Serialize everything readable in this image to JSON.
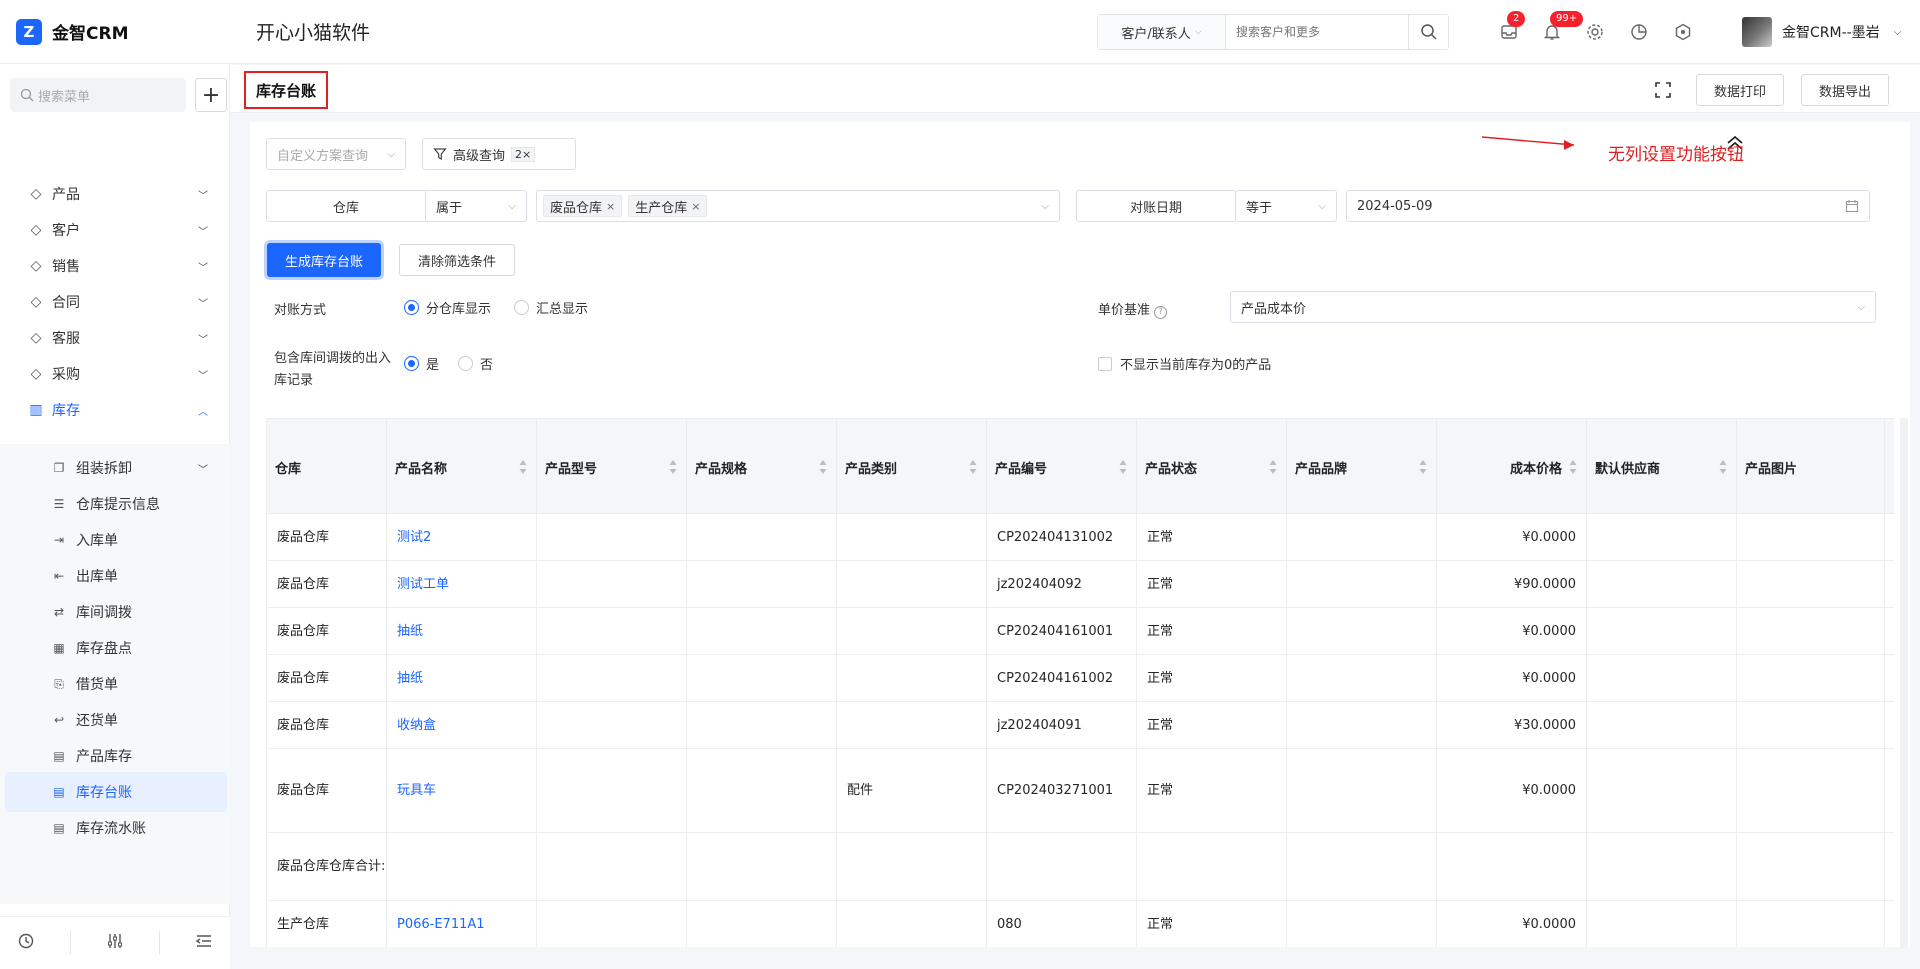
{
  "app": {
    "logo_text": "金智CRM",
    "company": "开心小猫软件"
  },
  "search": {
    "scope": "客户/联系人",
    "placeholder": "搜索客户和更多"
  },
  "notifications": {
    "messages_badge": "2",
    "alerts_badge": "99+"
  },
  "user": {
    "name": "金智CRM--墨岩"
  },
  "sidebar": {
    "search_placeholder": "搜索菜单",
    "menu": [
      {
        "label": "产品",
        "icon": "cube-icon"
      },
      {
        "label": "客户",
        "icon": "chart-icon"
      },
      {
        "label": "销售",
        "icon": "tag-icon"
      },
      {
        "label": "合同",
        "icon": "document-icon"
      },
      {
        "label": "客服",
        "icon": "headset-icon"
      },
      {
        "label": "采购",
        "icon": "bag-icon"
      },
      {
        "label": "库存",
        "icon": "warehouse-icon"
      }
    ],
    "submenu": [
      {
        "label": "组装拆卸",
        "icon": "copy-icon"
      },
      {
        "label": "仓库提示信息",
        "icon": "list-icon"
      },
      {
        "label": "入库单",
        "icon": "inbound-icon"
      },
      {
        "label": "出库单",
        "icon": "outbound-icon"
      },
      {
        "label": "库间调拨",
        "icon": "transfer-icon"
      },
      {
        "label": "库存盘点",
        "icon": "calculator-icon"
      },
      {
        "label": "借货单",
        "icon": "borrow-icon"
      },
      {
        "label": "还货单",
        "icon": "return-icon"
      },
      {
        "label": "产品库存",
        "icon": "file-icon"
      },
      {
        "label": "库存台账",
        "icon": "ledger-icon"
      },
      {
        "label": "库存流水账",
        "icon": "flow-icon"
      }
    ]
  },
  "page": {
    "title": "库存台账",
    "print_label": "数据打印",
    "export_label": "数据导出"
  },
  "filters": {
    "scheme_placeholder": "自定义方案查询",
    "advanced_label": "高级查询",
    "advanced_count": "2×",
    "warehouse_label": "仓库",
    "warehouse_op": "属于",
    "warehouse_tags": [
      "废品仓库",
      "生产仓库"
    ],
    "date_label": "对账日期",
    "date_op": "等于",
    "date_value": "2024-05-09",
    "generate_label": "生成库存台账",
    "clear_label": "清除筛选条件",
    "mode_label": "对账方式",
    "mode_opt1": "分仓库显示",
    "mode_opt2": "汇总显示",
    "price_label": "单价基准",
    "price_value": "产品成本价",
    "transfer_label": "包含库间调拨的出入库记录",
    "yes": "是",
    "no": "否",
    "zero_label": "不显示当前库存为0的产品"
  },
  "annotation": "无列设置功能按钮",
  "accent_color": "#1a66ff",
  "table": {
    "columns": [
      "仓库",
      "产品名称",
      "产品型号",
      "产品规格",
      "产品类别",
      "产品编号",
      "产品状态",
      "产品品牌",
      "成本价格",
      "默认供应商",
      "产品图片"
    ],
    "rows": [
      [
        "废品仓库",
        "测试2",
        "",
        "",
        "",
        "CP202404131002",
        "正常",
        "",
        "¥0.0000",
        "",
        ""
      ],
      [
        "废品仓库",
        "测试工单",
        "",
        "",
        "",
        "jz202404092",
        "正常",
        "",
        "¥90.0000",
        "",
        ""
      ],
      [
        "废品仓库",
        "抽纸",
        "",
        "",
        "",
        "CP202404161001",
        "正常",
        "",
        "¥0.0000",
        "",
        ""
      ],
      [
        "废品仓库",
        "抽纸",
        "",
        "",
        "",
        "CP202404161002",
        "正常",
        "",
        "¥0.0000",
        "",
        ""
      ],
      [
        "废品仓库",
        "收纳盒",
        "",
        "",
        "",
        "jz202404091",
        "正常",
        "",
        "¥30.0000",
        "",
        ""
      ],
      [
        "废品仓库",
        "玩具车",
        "",
        "",
        "配件",
        "CP202403271001",
        "正常",
        "",
        "¥0.0000",
        "",
        ""
      ],
      [
        "废品仓库仓库合计:",
        "",
        "",
        "",
        "",
        "",
        "",
        "",
        "",
        "",
        ""
      ],
      [
        "生产仓库",
        "P066-E711A1",
        "",
        "",
        "",
        "080",
        "正常",
        "",
        "¥0.0000",
        "",
        ""
      ]
    ]
  }
}
